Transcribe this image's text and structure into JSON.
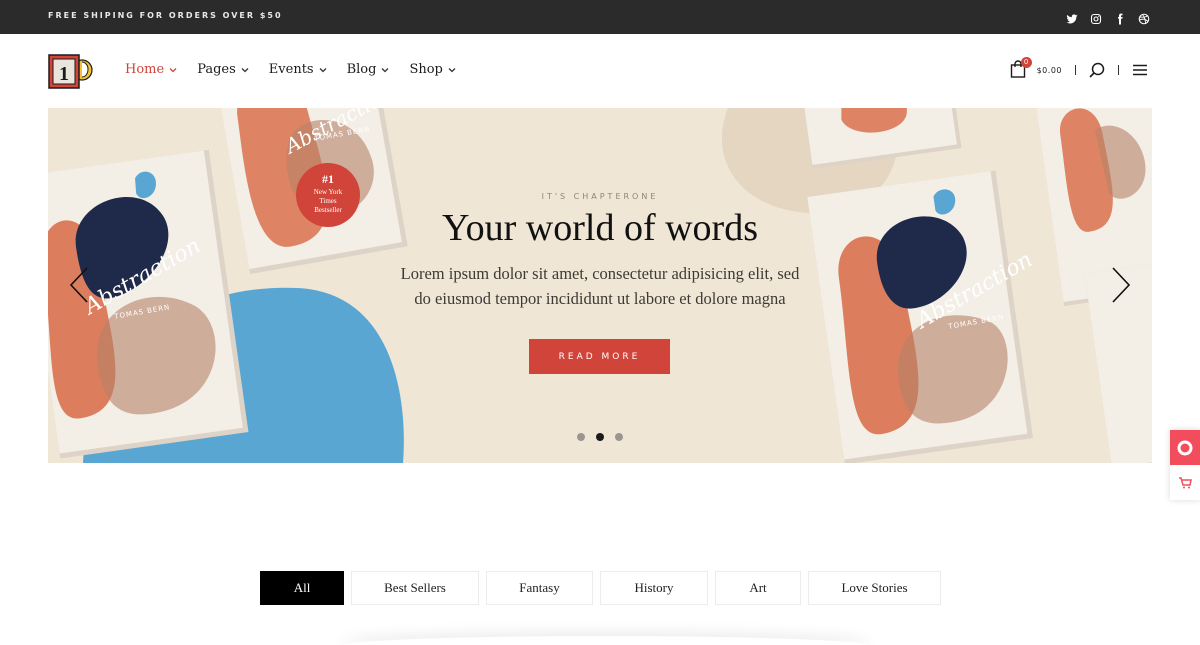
{
  "topbar": {
    "shipping_text": "FREE SHIPING FOR ORDERS OVER $50",
    "social_icons": [
      "twitter-icon",
      "instagram-icon",
      "facebook-icon",
      "dribbble-icon"
    ]
  },
  "header": {
    "logo_text": "1",
    "nav": [
      {
        "label": "Home",
        "active": true
      },
      {
        "label": "Pages",
        "active": false
      },
      {
        "label": "Events",
        "active": false
      },
      {
        "label": "Blog",
        "active": false
      },
      {
        "label": "Shop",
        "active": false
      }
    ],
    "cart_count": "0",
    "cart_total": "$0.00"
  },
  "hero": {
    "eyebrow": "IT'S CHAPTERONE",
    "headline": "Your world of words",
    "subtext_line1": "Lorem ipsum dolor sit amet, consectetur adipisicing elit, sed",
    "subtext_line2": "do eiusmod tempor incididunt ut labore et dolore magna",
    "cta_label": "READ MORE",
    "book_title": "Abstraction",
    "book_author": "TOMAS BERN",
    "badge_number": "#1",
    "badge_text_1": "New York",
    "badge_text_2": "Times",
    "badge_text_3": "Bestseller",
    "slides": 3,
    "active_slide": 2
  },
  "filters": [
    "All",
    "Best Sellers",
    "Fantasy",
    "History",
    "Art",
    "Love Stories"
  ],
  "colors": {
    "accent": "#d1443a",
    "topbar_bg": "#2b2b2b",
    "hero_bg": "#efe6d6",
    "blob_blue": "#5aa6d3",
    "book_orange": "#d9714e",
    "book_navy": "#1f2a4a"
  }
}
